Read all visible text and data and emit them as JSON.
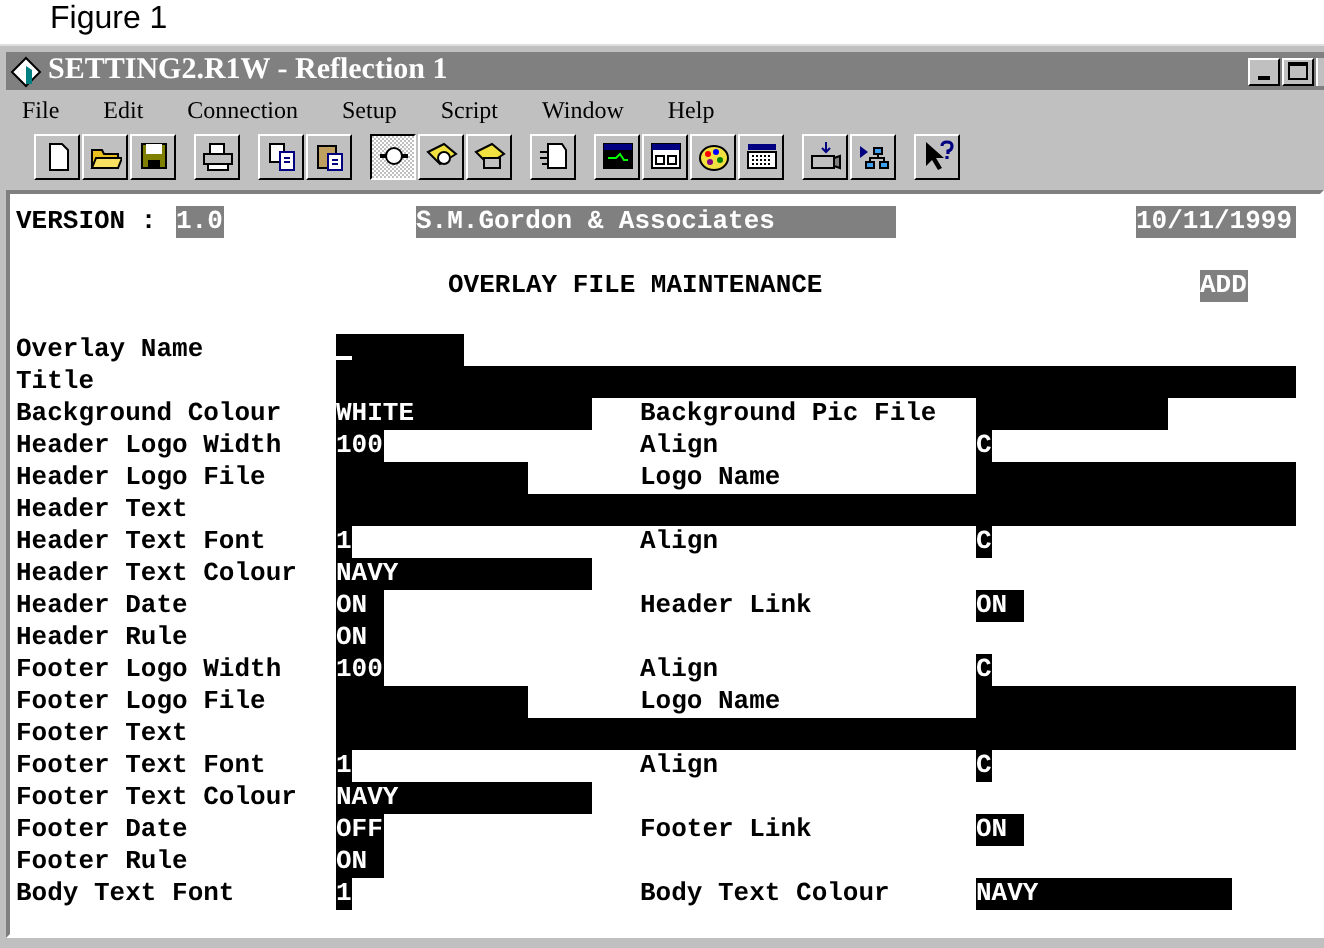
{
  "caption": "Figure 1",
  "window": {
    "title": "SETTING2.R1W - Reflection 1"
  },
  "menu": [
    "File",
    "Edit",
    "Connection",
    "Setup",
    "Script",
    "Window",
    "Help"
  ],
  "toolbar": [
    [
      {
        "kind": "new",
        "pressed": false
      },
      {
        "kind": "open",
        "pressed": false
      },
      {
        "kind": "save",
        "pressed": false
      }
    ],
    [
      {
        "kind": "print",
        "pressed": false
      }
    ],
    [
      {
        "kind": "copy",
        "pressed": false
      },
      {
        "kind": "paste",
        "pressed": false
      }
    ],
    [
      {
        "kind": "connect",
        "pressed": true
      },
      {
        "kind": "plug",
        "pressed": false
      },
      {
        "kind": "phone",
        "pressed": false
      }
    ],
    [
      {
        "kind": "page",
        "pressed": false
      }
    ],
    [
      {
        "kind": "monitor",
        "pressed": false
      },
      {
        "kind": "grid",
        "pressed": false
      },
      {
        "kind": "palette",
        "pressed": false
      },
      {
        "kind": "keyboard",
        "pressed": false
      }
    ],
    [
      {
        "kind": "camera",
        "pressed": false
      },
      {
        "kind": "flow",
        "pressed": false
      }
    ],
    [
      {
        "kind": "help",
        "pressed": false
      }
    ]
  ],
  "terminal": {
    "version_label": "VERSION :",
    "version": "1.0",
    "company": "S.M.Gordon & Associates",
    "date": "10/11/1999",
    "heading": "OVERLAY FILE MAINTENANCE",
    "mode": "ADD",
    "rows": [
      {
        "label": "Overlay Name",
        "value": "",
        "cursor": true
      },
      {
        "label": "Title",
        "value": ""
      },
      {
        "label": "Background Colour",
        "value": "WHITE",
        "right_label": "Background Pic File",
        "right_value": ""
      },
      {
        "label": "Header Logo Width",
        "value": "100",
        "right_label": "Align",
        "right_value": "C"
      },
      {
        "label": "Header Logo File",
        "value": "",
        "right_label": "Logo Name",
        "right_value": ""
      },
      {
        "label": "Header Text",
        "value": ""
      },
      {
        "label": "Header Text Font",
        "value": "1",
        "right_label": "Align",
        "right_value": "C"
      },
      {
        "label": "Header Text Colour",
        "value": "NAVY"
      },
      {
        "label": "Header Date",
        "value": "ON",
        "right_label": "Header Link",
        "right_value": "ON"
      },
      {
        "label": "Header Rule",
        "value": "ON"
      },
      {
        "label": "Footer Logo Width",
        "value": "100",
        "right_label": "Align",
        "right_value": "C"
      },
      {
        "label": "Footer Logo File",
        "value": "",
        "right_label": "Logo Name",
        "right_value": ""
      },
      {
        "label": "Footer Text",
        "value": ""
      },
      {
        "label": "Footer Text Font",
        "value": "1",
        "right_label": "Align",
        "right_value": "C"
      },
      {
        "label": "Footer Text Colour",
        "value": "NAVY"
      },
      {
        "label": "Footer Date",
        "value": "OFF",
        "right_label": "Footer Link",
        "right_value": "ON"
      },
      {
        "label": "Footer Rule",
        "value": "ON"
      },
      {
        "label": "Body Text Font",
        "value": "1",
        "right_label": "Body Text Colour",
        "right_value": "NAVY"
      }
    ]
  }
}
